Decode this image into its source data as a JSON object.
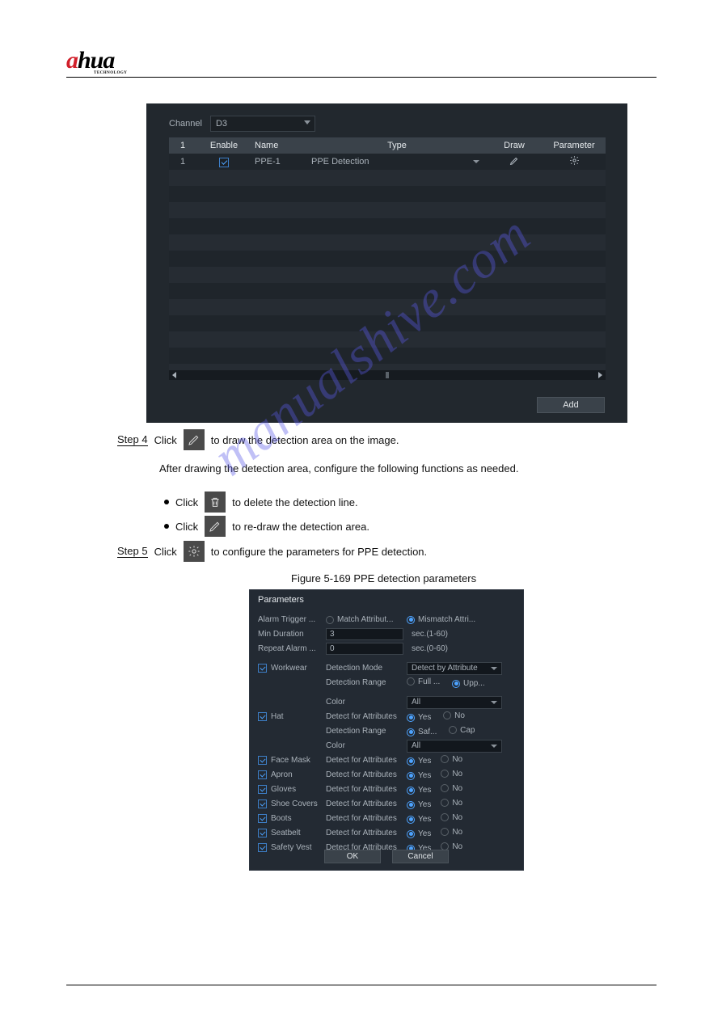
{
  "logo": {
    "a": "a",
    "hua": "hua",
    "sub": "TECHNOLOGY"
  },
  "watermark": "manualshive.com",
  "fig1": {
    "channel_label": "Channel",
    "channel_value": "D3",
    "headers": {
      "n": "1",
      "enable": "Enable",
      "name": "Name",
      "type": "Type",
      "draw": "Draw",
      "param": "Parameter"
    },
    "row1": {
      "n": "1",
      "name": "PPE-1",
      "type": "PPE Detection"
    },
    "add": "Add"
  },
  "steps": {
    "s4_a": "Step 4",
    "s4_b": "Click",
    "s4_c": "to draw the detection area on the image.",
    "s4_note": "After drawing the detection area, configure the following functions as needed.",
    "b1_a": "Click",
    "b1_b": "to re-draw the detection area.",
    "b2_a": "Click",
    "b2_b": "to delete the detection line.",
    "s5_a": "Step 5",
    "s5_b": "Click",
    "s5_c": "to configure the parameters for PPE detection.",
    "fig_caption": "Figure 5-169 PPE detection parameters"
  },
  "fig2": {
    "title": "Parameters",
    "alarm_trigger": "Alarm Trigger ...",
    "match": "Match Attribut...",
    "mismatch": "Mismatch Attri...",
    "min_dur": "Min Duration",
    "min_dur_v": "3",
    "min_dur_u": "sec.(1-60)",
    "repeat": "Repeat Alarm ...",
    "repeat_v": "0",
    "repeat_u": "sec.(0-60)",
    "workwear": "Workwear",
    "det_mode": "Detection Mode",
    "det_mode_v": "Detect by Attribute",
    "det_range": "Detection Range",
    "full": "Full ...",
    "upp": "Upp...",
    "color": "Color",
    "color_v": "All",
    "hat": "Hat",
    "dfa": "Detect for Attributes",
    "yes": "Yes",
    "no": "No",
    "saf": "Saf...",
    "cap": "Cap",
    "face_mask": "Face Mask",
    "apron": "Apron",
    "gloves": "Gloves",
    "shoe": "Shoe Covers",
    "boots": "Boots",
    "seatbelt": "Seatbelt",
    "vest": "Safety Vest",
    "ok": "OK",
    "cancel": "Cancel"
  }
}
